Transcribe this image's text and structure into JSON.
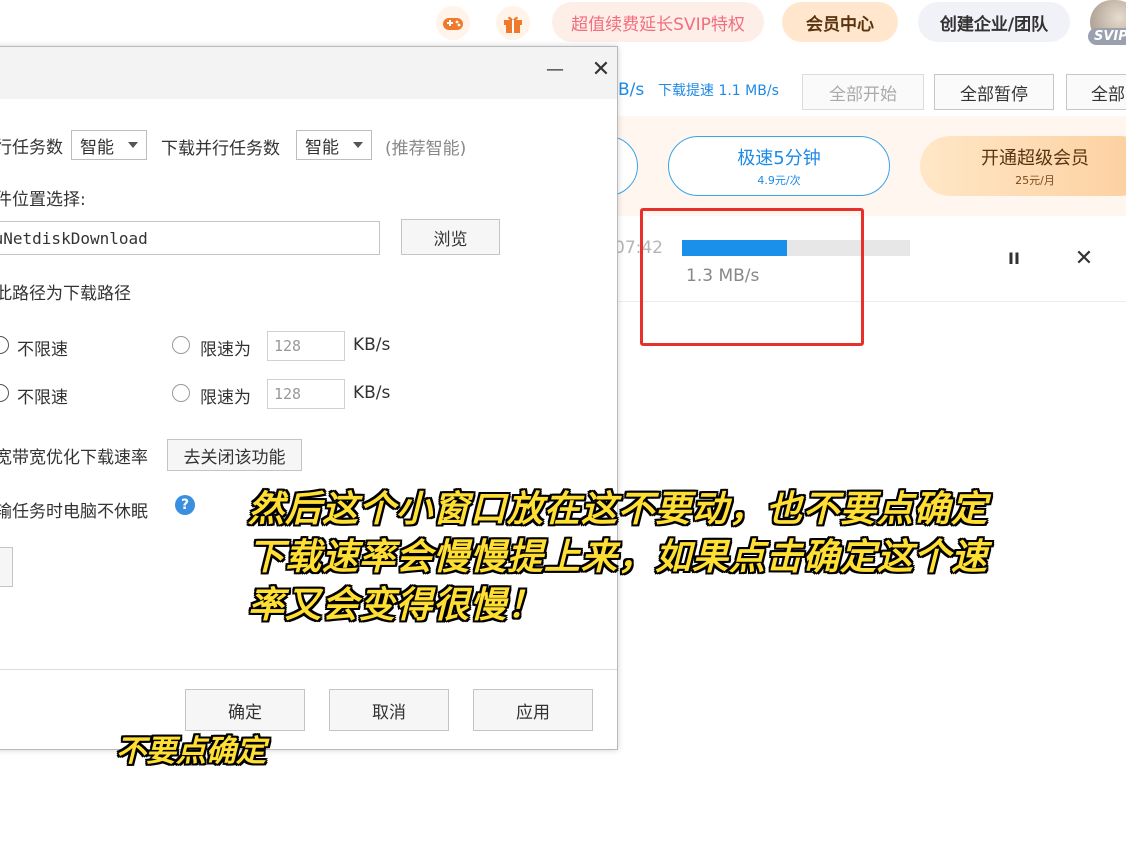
{
  "topbar": {
    "game_icon": "gamepad-icon",
    "gift_icon": "gift-icon",
    "promo_pill": "超值续费延长SVIP特权",
    "member_center": "会员中心",
    "create_team": "创建企业/团队",
    "avatar_badge": "SVIP"
  },
  "download_toolbar": {
    "upload_speed_fragment": "B/s",
    "download_speed": "下载提速 1.1 MB/s",
    "start_all": "全部开始",
    "pause_all": "全部暂停",
    "all_cut": "全部"
  },
  "promo": {
    "speed_title": "极速5分钟",
    "speed_price": "4.9元/次",
    "super_title": "开通超级会员",
    "super_price": "25元/月"
  },
  "task": {
    "time_left": "07:42",
    "progress_fraction": 0.46,
    "speed": "1.3 MB/s",
    "pause_glyph": "II",
    "close_glyph": "✕"
  },
  "dialog": {
    "minimize_glyph": "—",
    "close_glyph": "✕",
    "upload_parallel_label": "行任务数",
    "upload_parallel_value": "智能",
    "download_parallel_label": "下载并行任务数",
    "download_parallel_value": "智能",
    "recommend_hint": "(推荐智能)",
    "location_label": "件位置选择:",
    "path_value": "duNetdiskDownload",
    "browse_button": "浏览",
    "default_path_label": "此路径为下载路径",
    "upload_unlimited": "不限速",
    "upload_limit_label": "限速为",
    "upload_limit_value": "128",
    "upload_unit": "KB/s",
    "download_unlimited": "不限速",
    "download_limit_label": "限速为",
    "download_limit_value": "128",
    "download_unit": "KB/s",
    "bandwidth_label": "宽带宽优化下载速率",
    "disable_feature_button": "去关闭该功能",
    "no_sleep_label": "输任务时电脑不休眠",
    "help_glyph": "?",
    "ok_button": "确定",
    "cancel_button": "取消",
    "apply_button": "应用"
  },
  "caption": {
    "line1": "然后这个小窗口放在这不要动，也不要点确定",
    "line2": "下载速率会慢慢提上来，如果点击确定这个速",
    "line3": "率又会变得很慢！",
    "small": "不要点确定"
  },
  "colors": {
    "accent_blue": "#1a90ea",
    "highlight_red": "#e8302a",
    "caption_yellow": "#ffdf33"
  }
}
